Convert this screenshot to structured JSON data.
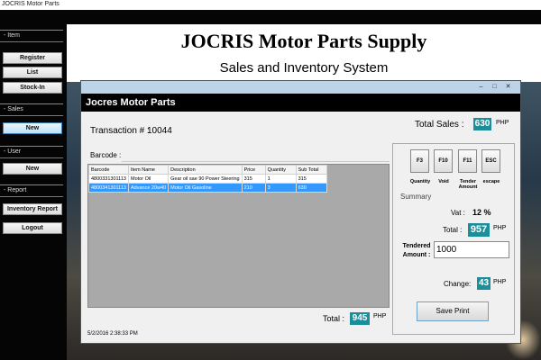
{
  "window": {
    "title": "JOCRIS Motor Parts"
  },
  "sidebar": {
    "sections": [
      {
        "title": "Item",
        "buttons": [
          "Register",
          "List",
          "Stock-In"
        ]
      },
      {
        "title": "Sales",
        "buttons": [
          "New"
        ]
      },
      {
        "title": "User",
        "buttons": [
          "New"
        ]
      },
      {
        "title": "Report",
        "buttons": [
          "Inventory Report",
          "Logout"
        ]
      }
    ]
  },
  "header": {
    "title": "JOCRIS Motor Parts Supply",
    "subtitle": "Sales and Inventory System"
  },
  "dialog": {
    "title": "Jocres Motor Parts",
    "transaction_label": "Transaction # :",
    "transaction_no": "10044",
    "total_sales_label": "Total Sales :",
    "total_sales_value": "630",
    "currency": "PHP",
    "barcode_label": "Barcode :",
    "table": {
      "columns": [
        "Barcode",
        "Item Name",
        "Description",
        "Price",
        "Quantity",
        "Sub Total"
      ],
      "rows": [
        [
          "4800331301113",
          "Motor Oil",
          "Gear oil sae 90 Power Steering",
          "315",
          "1",
          "315"
        ],
        [
          "4800341301113",
          "Advance 20w40",
          "Motor Oil Gasoline",
          "210",
          "3",
          "630"
        ]
      ]
    },
    "total_label": "Total :",
    "total_value": "945",
    "timestamp": "5/2/2016 2:38:33 PM",
    "fkeys": [
      {
        "key": "F3",
        "caption": "Quantity"
      },
      {
        "key": "F10",
        "caption": "Void"
      },
      {
        "key": "F11",
        "caption": "Tender Amount"
      },
      {
        "key": "ESC",
        "caption": "escape"
      }
    ],
    "summary": {
      "label": "Summary",
      "vat_label": "Vat :",
      "vat_value": "12 %",
      "total_label": "Total :",
      "total_value": "957",
      "tendered_label": "Tendered Amount :",
      "tendered_value": "1000",
      "change_label": "Change:",
      "change_value": "43"
    },
    "save_button": "Save  Print"
  }
}
